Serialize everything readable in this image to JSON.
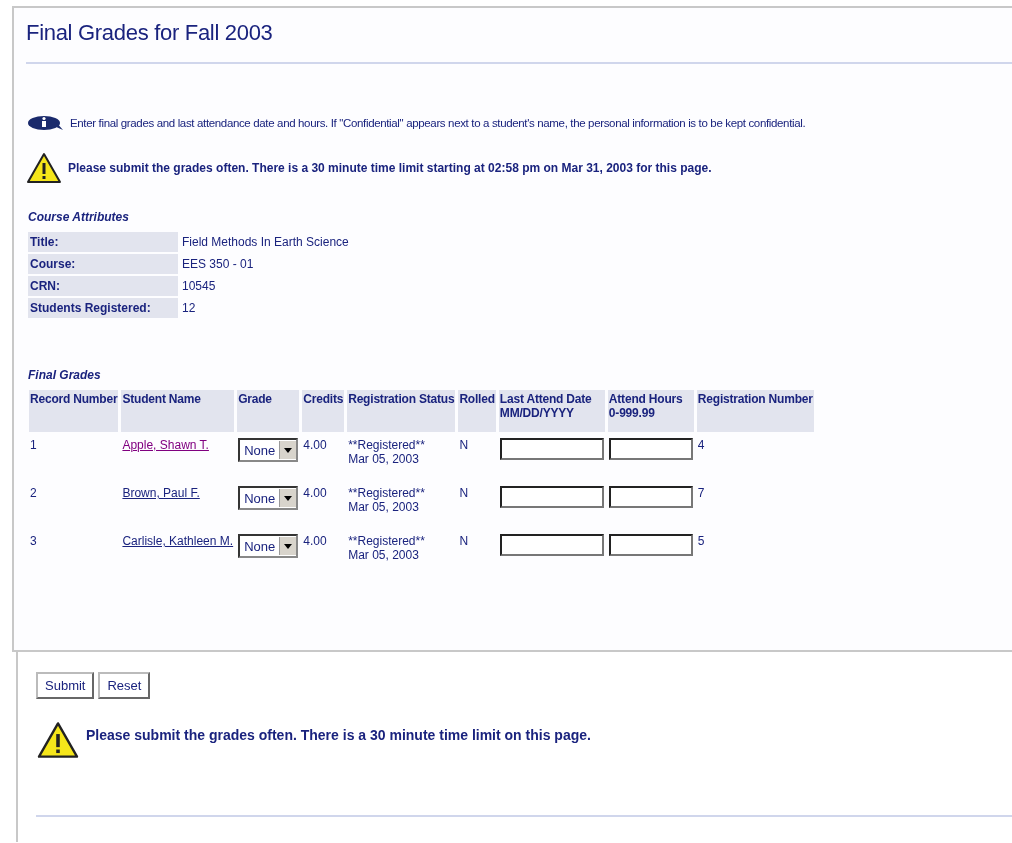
{
  "page": {
    "title": "Final Grades for Fall 2003"
  },
  "info_message": "Enter final grades and last attendance date and hours. If \"Confidential\" appears next to a student's name, the personal information is to be kept confidential.",
  "warning_top": "Please submit the grades often. There is a 30 minute time limit starting at 02:58 pm on Mar 31, 2003 for this page.",
  "course_attributes": {
    "heading": "Course Attributes",
    "rows": [
      {
        "label": "Title:",
        "value": "Field Methods In Earth Science"
      },
      {
        "label": "Course:",
        "value": "EES 350 - 01"
      },
      {
        "label": "CRN:",
        "value": "10545"
      },
      {
        "label": "Students Registered:",
        "value": "12"
      }
    ]
  },
  "final_grades": {
    "heading": "Final Grades",
    "columns": [
      {
        "label": "Record Number"
      },
      {
        "label": "Student Name"
      },
      {
        "label": "Grade"
      },
      {
        "label": "Credits"
      },
      {
        "label": "Registration Status"
      },
      {
        "label": "Rolled"
      },
      {
        "label": "Last Attend Date",
        "sub": "MM/DD/YYYY"
      },
      {
        "label": "Attend Hours",
        "sub": "0-999.99"
      },
      {
        "label": "Registration Number"
      }
    ],
    "rows": [
      {
        "record": "1",
        "name": "Apple, Shawn T.",
        "visited": true,
        "grade": "None",
        "credits": "4.00",
        "status": "**Registered**",
        "status_date": "Mar 05, 2003",
        "rolled": "N",
        "reg_number": "4"
      },
      {
        "record": "2",
        "name": "Brown, Paul F.",
        "visited": false,
        "grade": "None",
        "credits": "4.00",
        "status": "**Registered**",
        "status_date": "Mar 05, 2003",
        "rolled": "N",
        "reg_number": "7"
      },
      {
        "record": "3",
        "name": "Carlisle, Kathleen M.",
        "visited": false,
        "grade": "None",
        "credits": "4.00",
        "status": "**Registered**",
        "status_date": "Mar 05, 2003",
        "rolled": "N",
        "reg_number": "5"
      }
    ]
  },
  "buttons": [
    {
      "label": "Submit"
    },
    {
      "label": "Reset"
    }
  ],
  "warning_bottom": "Please submit the grades often. There is a 30 minute time limit on this page."
}
